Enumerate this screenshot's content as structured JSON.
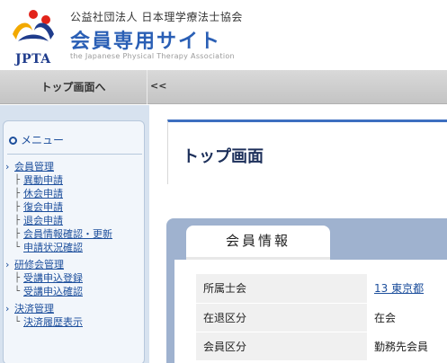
{
  "header": {
    "logo_text": "JPTA",
    "org_name": "公益社団法人 日本理学療法士協会",
    "site_title": "会員専用サイト",
    "site_subtitle": "the Japanese Physical Therapy Association"
  },
  "navbar": {
    "home_label": "トップ画面へ",
    "collapse_label": "<<"
  },
  "sidebar": {
    "menu_title": "メニュー",
    "groups": [
      {
        "title": "会員管理",
        "items": [
          "異動申請",
          "休会申請",
          "復会申請",
          "退会申請",
          "会員情報確認・更新",
          "申請状況確認"
        ]
      },
      {
        "title": "研修会管理",
        "items": [
          "受講申込登録",
          "受講申込確認"
        ]
      },
      {
        "title": "決済管理",
        "items": [
          "決済履歴表示"
        ]
      }
    ]
  },
  "main": {
    "page_title": "トップ画面",
    "info_tab_label": "会員情報",
    "rows": [
      {
        "label": "所属士会",
        "value": "13 東京都",
        "link": true
      },
      {
        "label": "在退区分",
        "value": "在会",
        "link": false
      },
      {
        "label": "会員区分",
        "value": "勤務先会員",
        "link": false
      }
    ]
  },
  "colors": {
    "accent": "#2a5fb5",
    "link": "#1d4f9c",
    "sidebar_bg": "#d7e2ef",
    "panel_bg": "#9fb2cf"
  }
}
